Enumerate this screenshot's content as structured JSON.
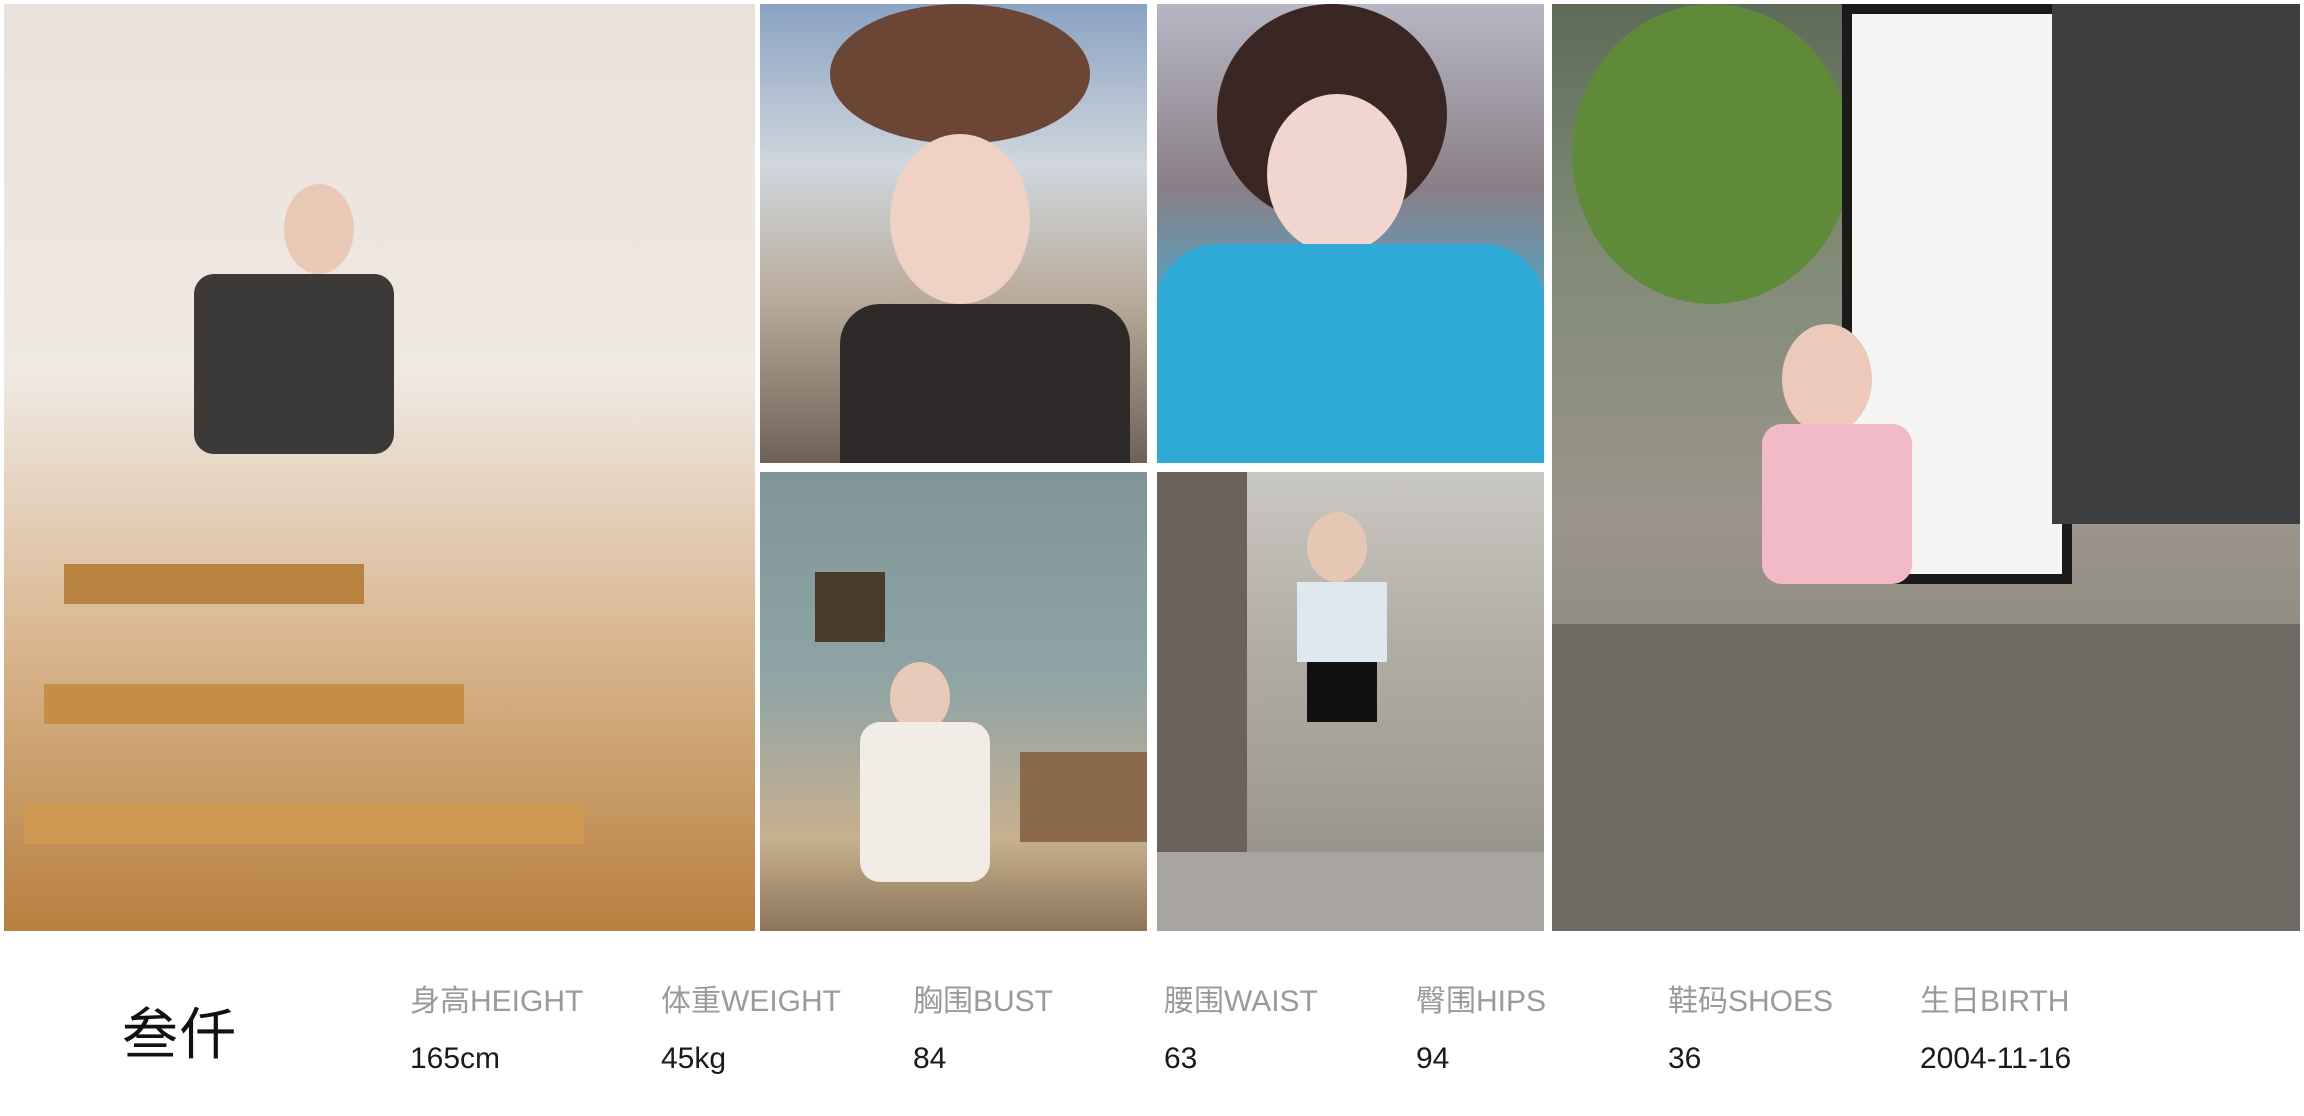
{
  "profile": {
    "name": "叁仟",
    "stats": [
      {
        "label": "身高HEIGHT",
        "value": "165cm"
      },
      {
        "label": "体重WEIGHT",
        "value": "45kg"
      },
      {
        "label": "胸围BUST",
        "value": "84"
      },
      {
        "label": "腰围WAIST",
        "value": "63"
      },
      {
        "label": "臀围HIPS",
        "value": "94"
      },
      {
        "label": "鞋码SHOES",
        "value": "36"
      },
      {
        "label": "生日BIRTH",
        "value": "2004-11-16"
      }
    ]
  }
}
